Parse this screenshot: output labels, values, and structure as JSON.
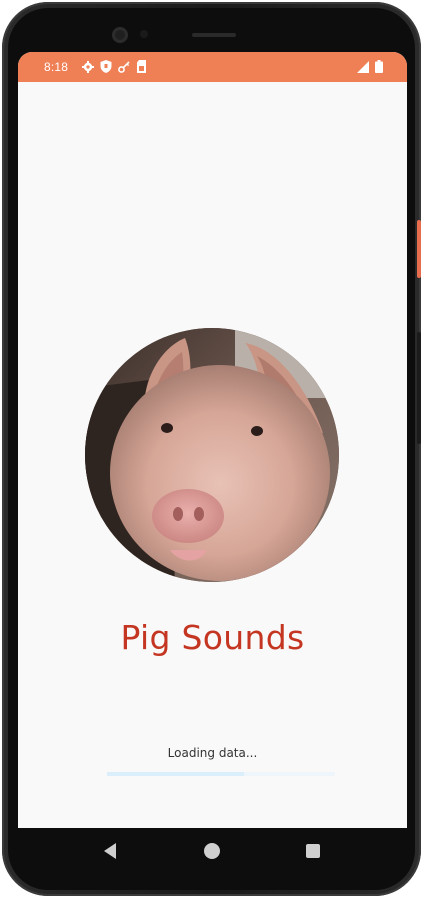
{
  "status_bar": {
    "time": "8:18",
    "background_color": "#ef7f55",
    "left_icons": [
      "settings-icon",
      "shield-icon",
      "key-icon",
      "sim-card-icon"
    ],
    "right_icons": [
      "signal-icon",
      "battery-icon"
    ]
  },
  "splash": {
    "image_icon": "pig-photo",
    "title": "Pig Sounds",
    "title_color": "#c43621",
    "loading_text": "Loading data...",
    "loading_progress": 0.6
  },
  "nav_bar": {
    "buttons": [
      "back-icon",
      "home-icon",
      "recents-icon"
    ]
  }
}
